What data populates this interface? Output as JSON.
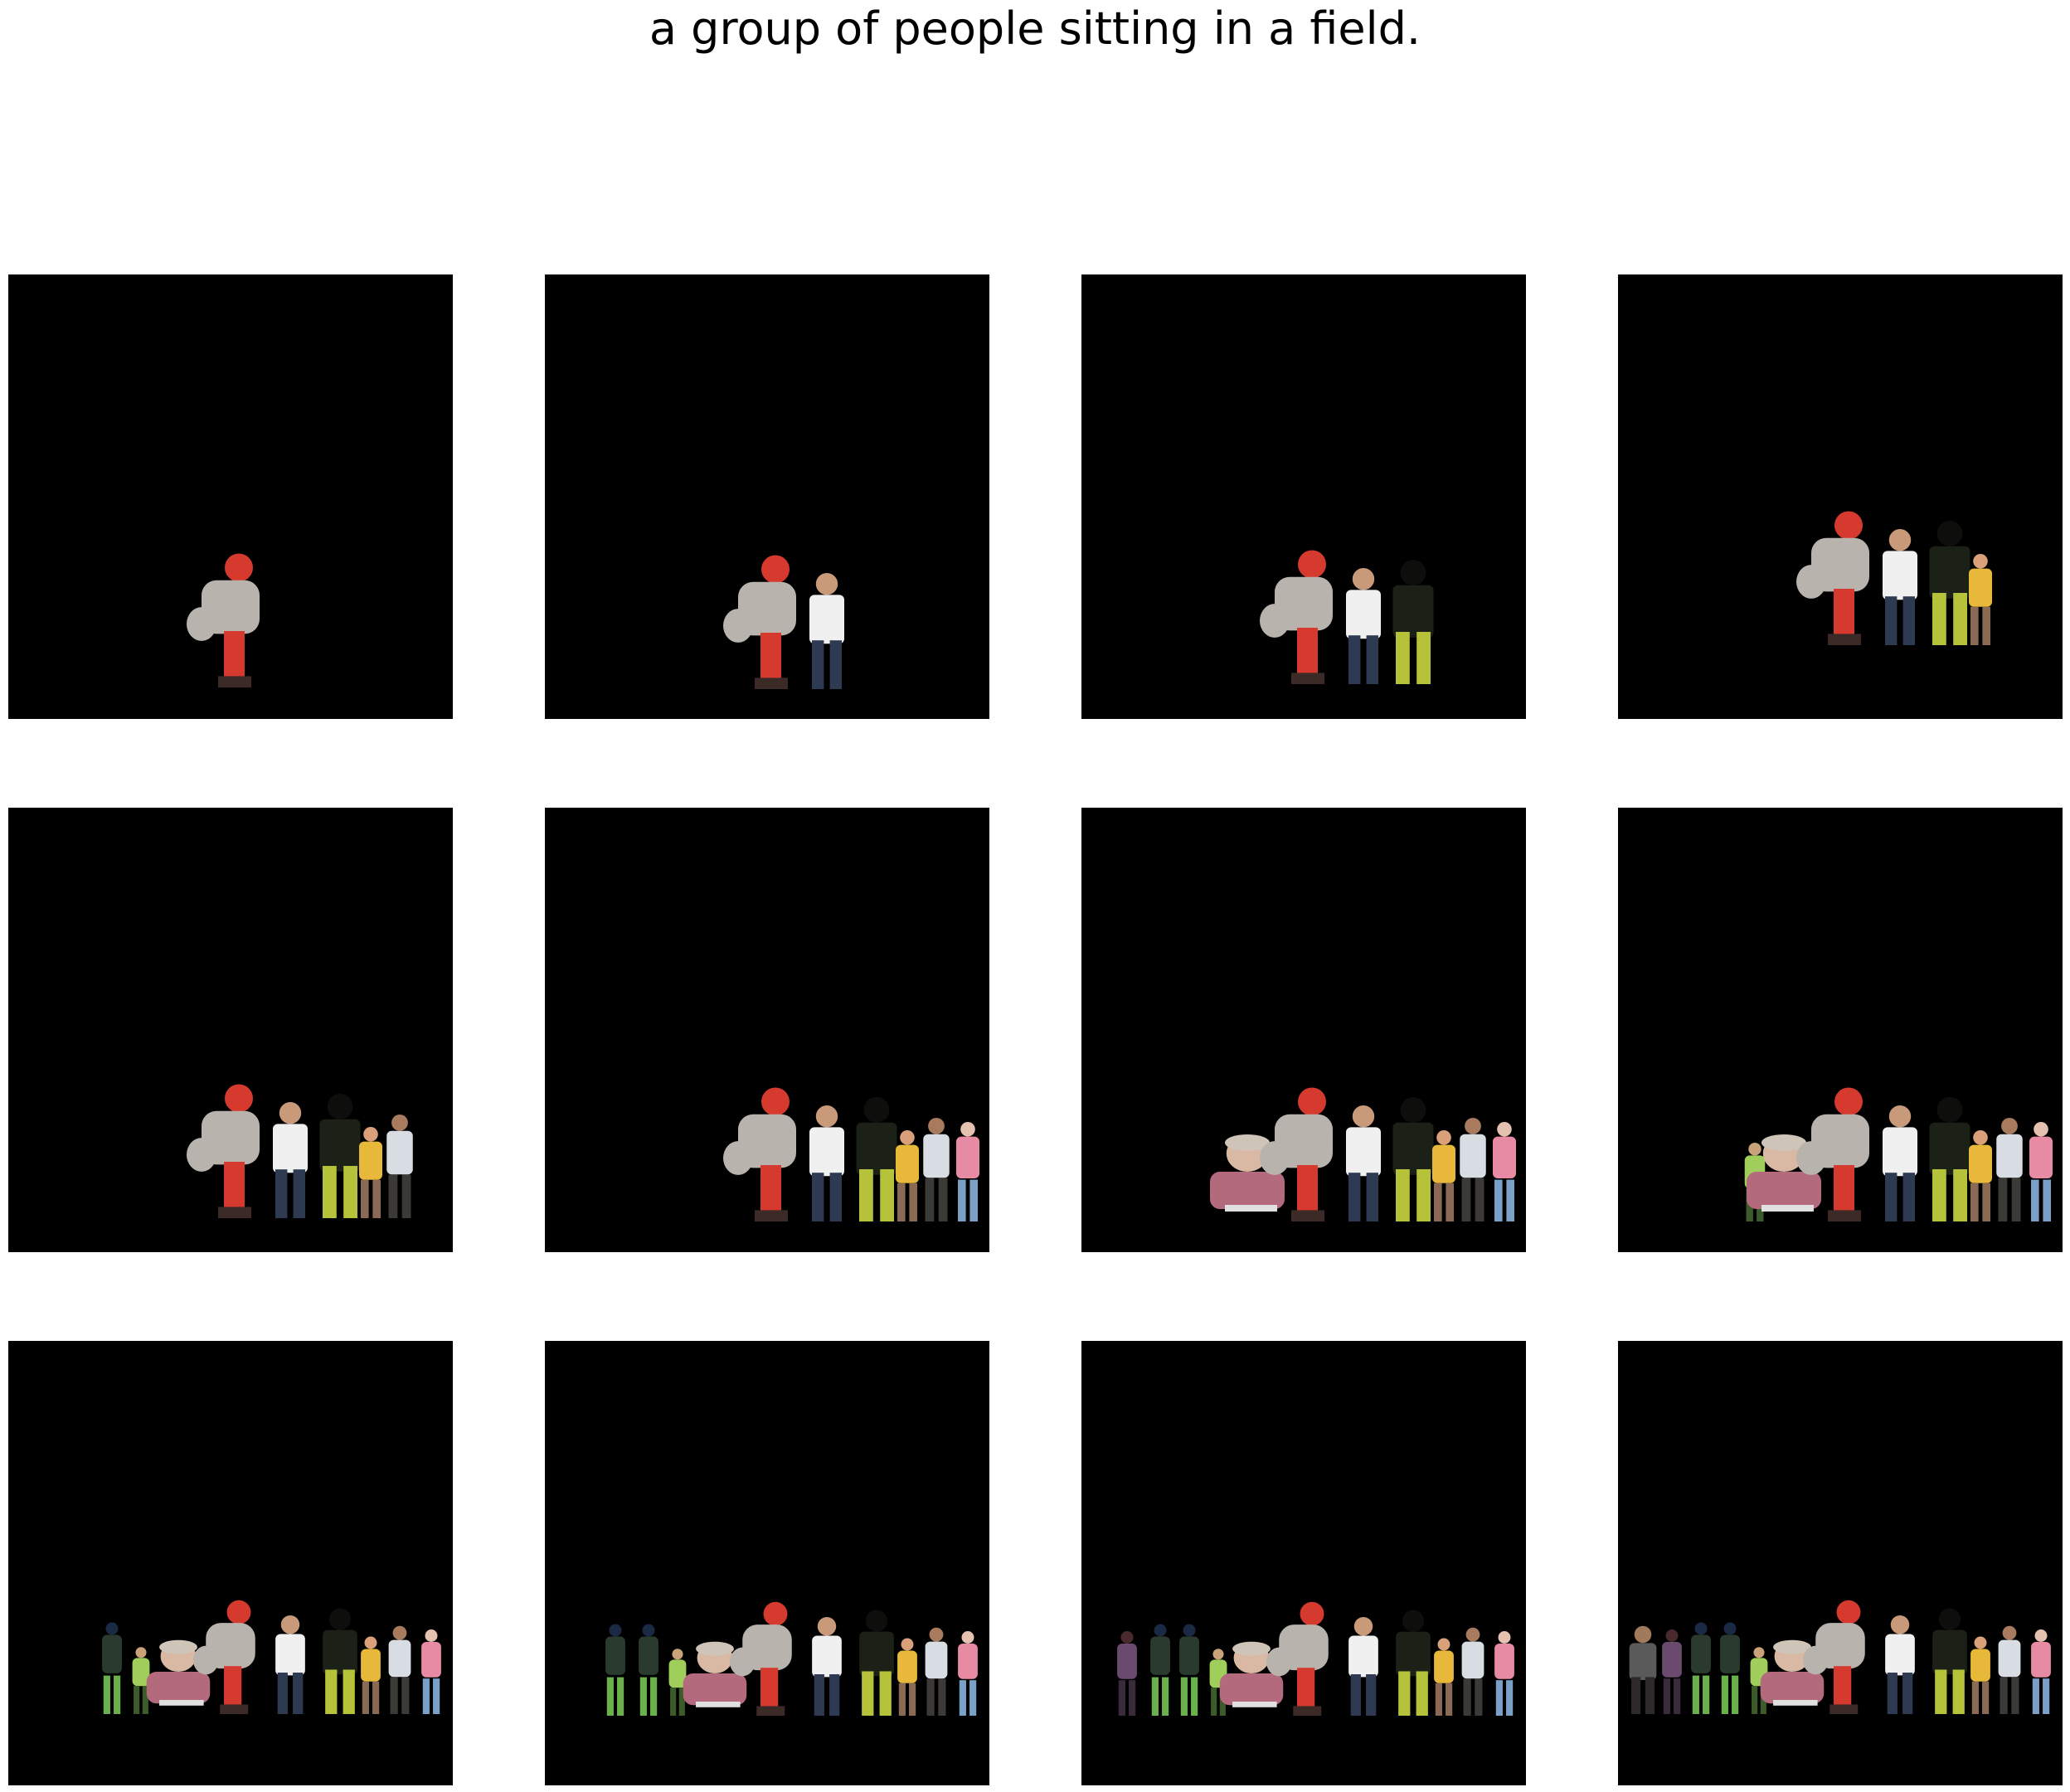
{
  "title": "a group of people sitting in a field.",
  "figure": {
    "rows": 3,
    "cols": 4,
    "panel_background": "#000000",
    "page_background": "#ffffff",
    "panels": [
      {
        "figures": [
          "catcher-red"
        ]
      },
      {
        "figures": [
          "catcher-red",
          "person-white-shirt"
        ]
      },
      {
        "figures": [
          "catcher-red",
          "person-white-shirt",
          "person-dark-green"
        ]
      },
      {
        "figures": [
          "catcher-red",
          "person-white-shirt",
          "person-dark-green",
          "person-yellow"
        ]
      },
      {
        "figures": [
          "catcher-red",
          "person-white-shirt",
          "person-dark-green",
          "person-yellow",
          "person-light-top"
        ]
      },
      {
        "figures": [
          "catcher-red",
          "person-white-shirt",
          "person-dark-green",
          "person-yellow",
          "person-light-top",
          "person-pink"
        ]
      },
      {
        "figures": [
          "woman-pink-closeup",
          "catcher-red",
          "person-white-shirt",
          "person-dark-green",
          "person-yellow",
          "person-light-top",
          "person-pink"
        ]
      },
      {
        "figures": [
          "child-green",
          "woman-pink-closeup",
          "catcher-red",
          "person-white-shirt",
          "person-dark-green",
          "person-yellow",
          "person-light-top",
          "person-pink"
        ]
      },
      {
        "figures": [
          "boy-dark-shirt",
          "child-green",
          "woman-pink-closeup",
          "catcher-red",
          "person-white-shirt",
          "person-dark-green",
          "person-yellow",
          "person-light-top",
          "person-pink"
        ]
      },
      {
        "figures": [
          "boy-dark-shirt",
          "boy-dark-shirt",
          "child-green",
          "woman-pink-closeup",
          "catcher-red",
          "person-white-shirt",
          "person-dark-green",
          "person-yellow",
          "person-light-top",
          "person-pink"
        ]
      },
      {
        "figures": [
          "person-purple",
          "boy-dark-shirt",
          "boy-dark-shirt",
          "child-green",
          "woman-pink-closeup",
          "catcher-red",
          "person-white-shirt",
          "person-dark-green",
          "person-yellow",
          "person-light-top",
          "person-pink"
        ]
      },
      {
        "figures": [
          "person-grey-arms-raised",
          "person-purple",
          "boy-dark-shirt",
          "boy-dark-shirt",
          "child-green",
          "woman-pink-closeup",
          "catcher-red",
          "person-white-shirt",
          "person-dark-green",
          "person-yellow",
          "person-light-top",
          "person-pink"
        ]
      }
    ],
    "figure_colors": {
      "catcher-red": {
        "main": "#b8b3ad",
        "accent": "#d63a2f",
        "dark": "#3b2a26"
      },
      "person-white-shirt": {
        "main": "#f0f0f0",
        "accent": "#2e3a52",
        "dark": "#c89a7a"
      },
      "person-dark-green": {
        "main": "#1c2118",
        "accent": "#b6c23a",
        "dark": "#0e0f0d"
      },
      "person-yellow": {
        "main": "#e8b83a",
        "accent": "#8a6a55",
        "dark": "#d9a07a"
      },
      "person-light-top": {
        "main": "#d7dde2",
        "accent": "#3c3a36",
        "dark": "#a87a5e"
      },
      "person-pink": {
        "main": "#e78aa3",
        "accent": "#7aa0c8",
        "dark": "#e5c1b0"
      },
      "woman-pink-closeup": {
        "main": "#b36a7c",
        "accent": "#d9b9a3",
        "dark": "#8a5a68"
      },
      "child-green": {
        "main": "#9fcf5a",
        "accent": "#3c5a2a",
        "dark": "#c9a27a"
      },
      "boy-dark-shirt": {
        "main": "#2a3a2e",
        "accent": "#6ab04c",
        "dark": "#1b2a44"
      },
      "person-purple": {
        "main": "#6a4a6e",
        "accent": "#3a2a3a",
        "dark": "#4a2a2e"
      },
      "person-grey-arms-raised": {
        "main": "#5a5a5a",
        "accent": "#2f2a2a",
        "dark": "#a07a5a"
      }
    }
  }
}
